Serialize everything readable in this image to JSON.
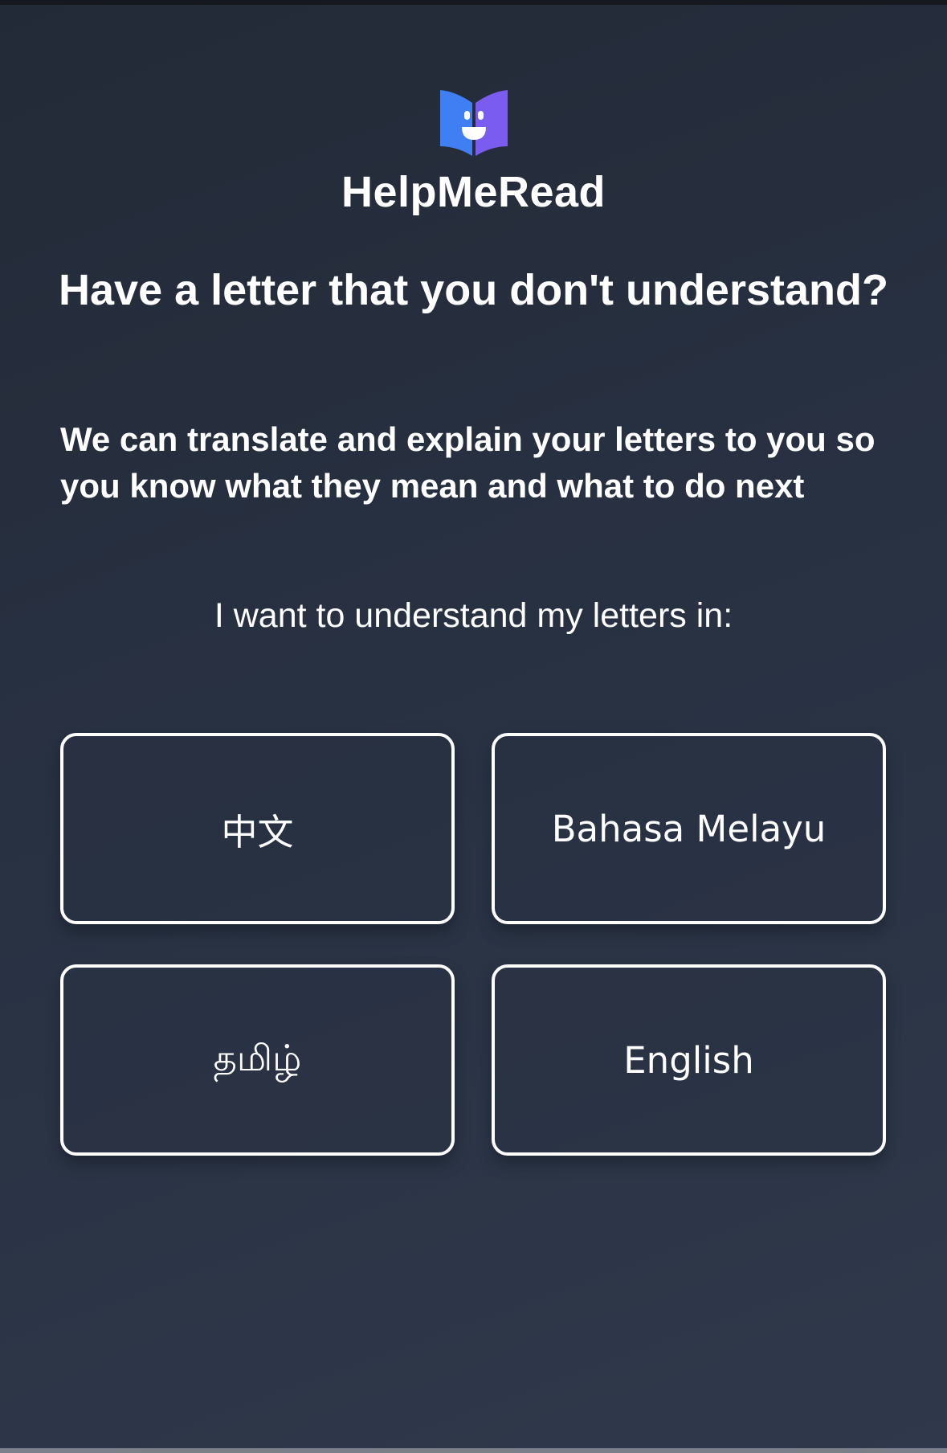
{
  "app": {
    "name": "HelpMeRead",
    "logo_icon": "open-book-smiley-icon",
    "colors": {
      "background": "#283142",
      "logo_blue": "#3f7ff3",
      "logo_purple": "#7a5cf0",
      "text": "#ffffff",
      "button_border": "#ffffff"
    }
  },
  "main": {
    "headline": "Have a letter that you don't understand?",
    "description": "We can translate and explain your letters to you so you know what they mean and what to do next",
    "prompt": "I want to understand my letters in:"
  },
  "languages": [
    {
      "label": "中文"
    },
    {
      "label": "Bahasa Melayu"
    },
    {
      "label": "தமிழ்"
    },
    {
      "label": "English"
    }
  ]
}
